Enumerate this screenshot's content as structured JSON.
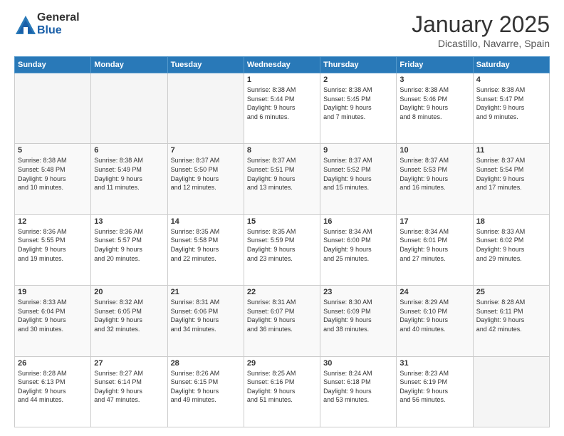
{
  "logo": {
    "general": "General",
    "blue": "Blue"
  },
  "header": {
    "month": "January 2025",
    "location": "Dicastillo, Navarre, Spain"
  },
  "weekdays": [
    "Sunday",
    "Monday",
    "Tuesday",
    "Wednesday",
    "Thursday",
    "Friday",
    "Saturday"
  ],
  "weeks": [
    [
      {
        "day": "",
        "info": ""
      },
      {
        "day": "",
        "info": ""
      },
      {
        "day": "",
        "info": ""
      },
      {
        "day": "1",
        "info": "Sunrise: 8:38 AM\nSunset: 5:44 PM\nDaylight: 9 hours\nand 6 minutes."
      },
      {
        "day": "2",
        "info": "Sunrise: 8:38 AM\nSunset: 5:45 PM\nDaylight: 9 hours\nand 7 minutes."
      },
      {
        "day": "3",
        "info": "Sunrise: 8:38 AM\nSunset: 5:46 PM\nDaylight: 9 hours\nand 8 minutes."
      },
      {
        "day": "4",
        "info": "Sunrise: 8:38 AM\nSunset: 5:47 PM\nDaylight: 9 hours\nand 9 minutes."
      }
    ],
    [
      {
        "day": "5",
        "info": "Sunrise: 8:38 AM\nSunset: 5:48 PM\nDaylight: 9 hours\nand 10 minutes."
      },
      {
        "day": "6",
        "info": "Sunrise: 8:38 AM\nSunset: 5:49 PM\nDaylight: 9 hours\nand 11 minutes."
      },
      {
        "day": "7",
        "info": "Sunrise: 8:37 AM\nSunset: 5:50 PM\nDaylight: 9 hours\nand 12 minutes."
      },
      {
        "day": "8",
        "info": "Sunrise: 8:37 AM\nSunset: 5:51 PM\nDaylight: 9 hours\nand 13 minutes."
      },
      {
        "day": "9",
        "info": "Sunrise: 8:37 AM\nSunset: 5:52 PM\nDaylight: 9 hours\nand 15 minutes."
      },
      {
        "day": "10",
        "info": "Sunrise: 8:37 AM\nSunset: 5:53 PM\nDaylight: 9 hours\nand 16 minutes."
      },
      {
        "day": "11",
        "info": "Sunrise: 8:37 AM\nSunset: 5:54 PM\nDaylight: 9 hours\nand 17 minutes."
      }
    ],
    [
      {
        "day": "12",
        "info": "Sunrise: 8:36 AM\nSunset: 5:55 PM\nDaylight: 9 hours\nand 19 minutes."
      },
      {
        "day": "13",
        "info": "Sunrise: 8:36 AM\nSunset: 5:57 PM\nDaylight: 9 hours\nand 20 minutes."
      },
      {
        "day": "14",
        "info": "Sunrise: 8:35 AM\nSunset: 5:58 PM\nDaylight: 9 hours\nand 22 minutes."
      },
      {
        "day": "15",
        "info": "Sunrise: 8:35 AM\nSunset: 5:59 PM\nDaylight: 9 hours\nand 23 minutes."
      },
      {
        "day": "16",
        "info": "Sunrise: 8:34 AM\nSunset: 6:00 PM\nDaylight: 9 hours\nand 25 minutes."
      },
      {
        "day": "17",
        "info": "Sunrise: 8:34 AM\nSunset: 6:01 PM\nDaylight: 9 hours\nand 27 minutes."
      },
      {
        "day": "18",
        "info": "Sunrise: 8:33 AM\nSunset: 6:02 PM\nDaylight: 9 hours\nand 29 minutes."
      }
    ],
    [
      {
        "day": "19",
        "info": "Sunrise: 8:33 AM\nSunset: 6:04 PM\nDaylight: 9 hours\nand 30 minutes."
      },
      {
        "day": "20",
        "info": "Sunrise: 8:32 AM\nSunset: 6:05 PM\nDaylight: 9 hours\nand 32 minutes."
      },
      {
        "day": "21",
        "info": "Sunrise: 8:31 AM\nSunset: 6:06 PM\nDaylight: 9 hours\nand 34 minutes."
      },
      {
        "day": "22",
        "info": "Sunrise: 8:31 AM\nSunset: 6:07 PM\nDaylight: 9 hours\nand 36 minutes."
      },
      {
        "day": "23",
        "info": "Sunrise: 8:30 AM\nSunset: 6:09 PM\nDaylight: 9 hours\nand 38 minutes."
      },
      {
        "day": "24",
        "info": "Sunrise: 8:29 AM\nSunset: 6:10 PM\nDaylight: 9 hours\nand 40 minutes."
      },
      {
        "day": "25",
        "info": "Sunrise: 8:28 AM\nSunset: 6:11 PM\nDaylight: 9 hours\nand 42 minutes."
      }
    ],
    [
      {
        "day": "26",
        "info": "Sunrise: 8:28 AM\nSunset: 6:13 PM\nDaylight: 9 hours\nand 44 minutes."
      },
      {
        "day": "27",
        "info": "Sunrise: 8:27 AM\nSunset: 6:14 PM\nDaylight: 9 hours\nand 47 minutes."
      },
      {
        "day": "28",
        "info": "Sunrise: 8:26 AM\nSunset: 6:15 PM\nDaylight: 9 hours\nand 49 minutes."
      },
      {
        "day": "29",
        "info": "Sunrise: 8:25 AM\nSunset: 6:16 PM\nDaylight: 9 hours\nand 51 minutes."
      },
      {
        "day": "30",
        "info": "Sunrise: 8:24 AM\nSunset: 6:18 PM\nDaylight: 9 hours\nand 53 minutes."
      },
      {
        "day": "31",
        "info": "Sunrise: 8:23 AM\nSunset: 6:19 PM\nDaylight: 9 hours\nand 56 minutes."
      },
      {
        "day": "",
        "info": ""
      }
    ]
  ]
}
